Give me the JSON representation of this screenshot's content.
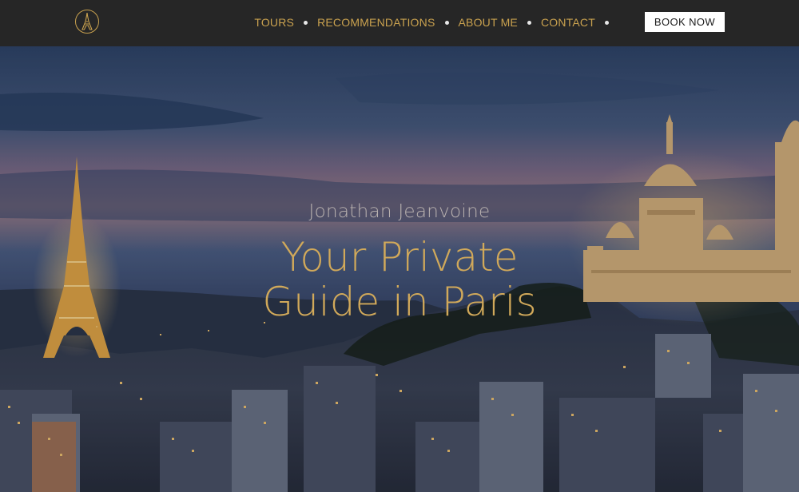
{
  "nav": {
    "logo_icon": "eiffel-tower-icon",
    "items": [
      {
        "label": "TOURS"
      },
      {
        "label": "RECOMMENDATIONS"
      },
      {
        "label": "ABOUT ME"
      },
      {
        "label": "CONTACT"
      }
    ],
    "book_label": "BOOK NOW"
  },
  "hero": {
    "name": "Jonathan Jeanvoine",
    "title_line1": "Your Private",
    "title_line2": "Guide in Paris",
    "image": "paris-skyline-eiffel-tower-sacre-coeur-dusk"
  },
  "colors": {
    "nav_bg": "#262626",
    "accent_gold": "#caa24f",
    "button_bg": "#ffffff"
  }
}
